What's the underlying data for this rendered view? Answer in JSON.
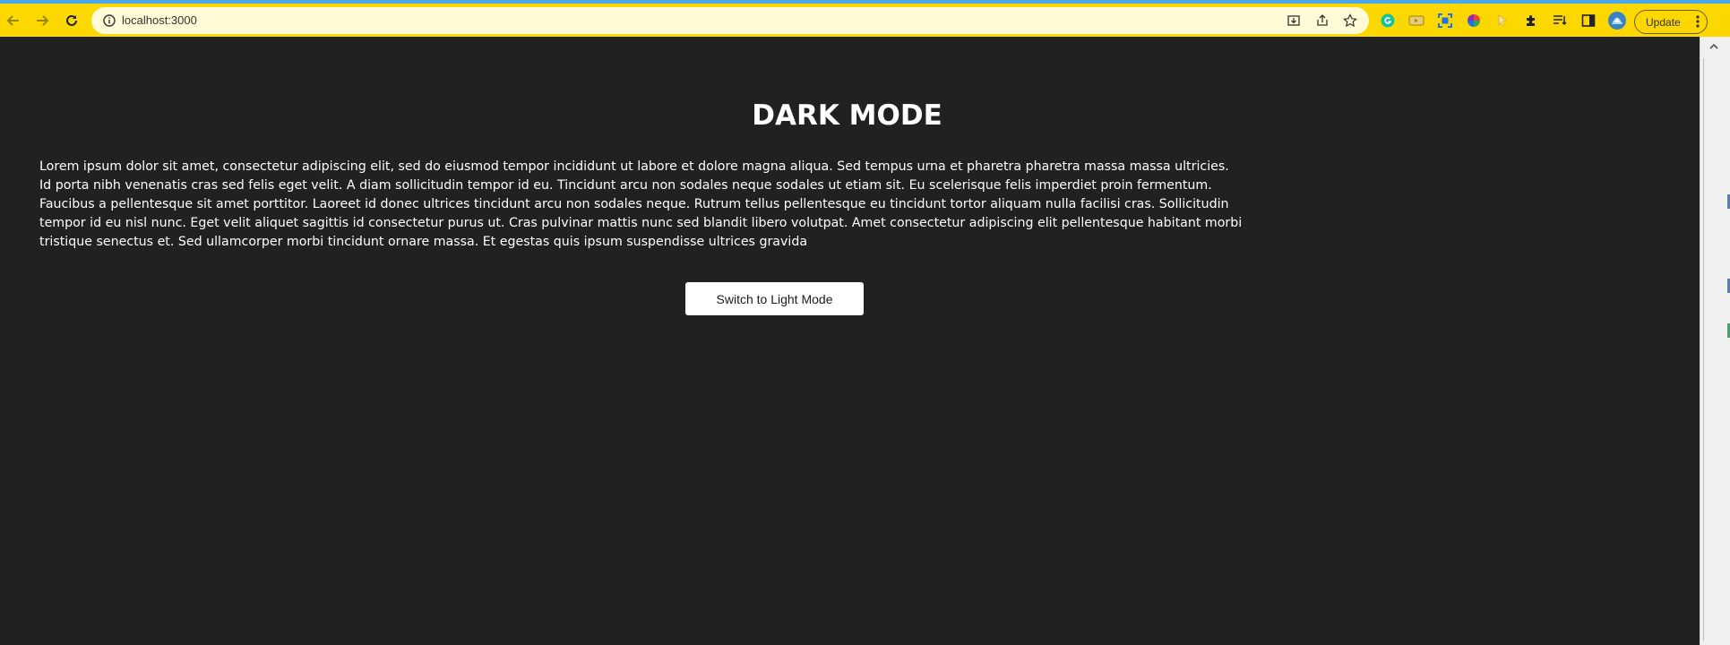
{
  "browser": {
    "url": "localhost:3000",
    "update_label": "Update",
    "accent_color": "#fdd700"
  },
  "page": {
    "title": "DARK MODE",
    "body": "Lorem ipsum dolor sit amet, consectetur adipiscing elit, sed do eiusmod tempor incididunt ut labore et dolore magna aliqua. Sed tempus urna et pharetra pharetra massa massa ultricies. Id porta nibh venenatis cras sed felis eget velit. A diam sollicitudin tempor id eu. Tincidunt arcu non sodales neque sodales ut etiam sit. Eu scelerisque felis imperdiet proin fermentum. Faucibus a pellentesque sit amet porttitor. Laoreet id donec ultrices tincidunt arcu non sodales neque. Rutrum tellus pellentesque eu tincidunt tortor aliquam nulla facilisi cras. Sollicitudin tempor id eu nisl nunc. Eget velit aliquet sagittis id consectetur purus ut. Cras pulvinar mattis nunc sed blandit libero volutpat. Amet consectetur adipiscing elit pellentesque habitant morbi tristique senectus et. Sed ullamcorper morbi tincidunt ornare massa. Et egestas quis ipsum suspendisse ultrices gravida",
    "toggle_label": "Switch to Light Mode",
    "background_color": "#212121",
    "text_color": "#ffffff"
  }
}
